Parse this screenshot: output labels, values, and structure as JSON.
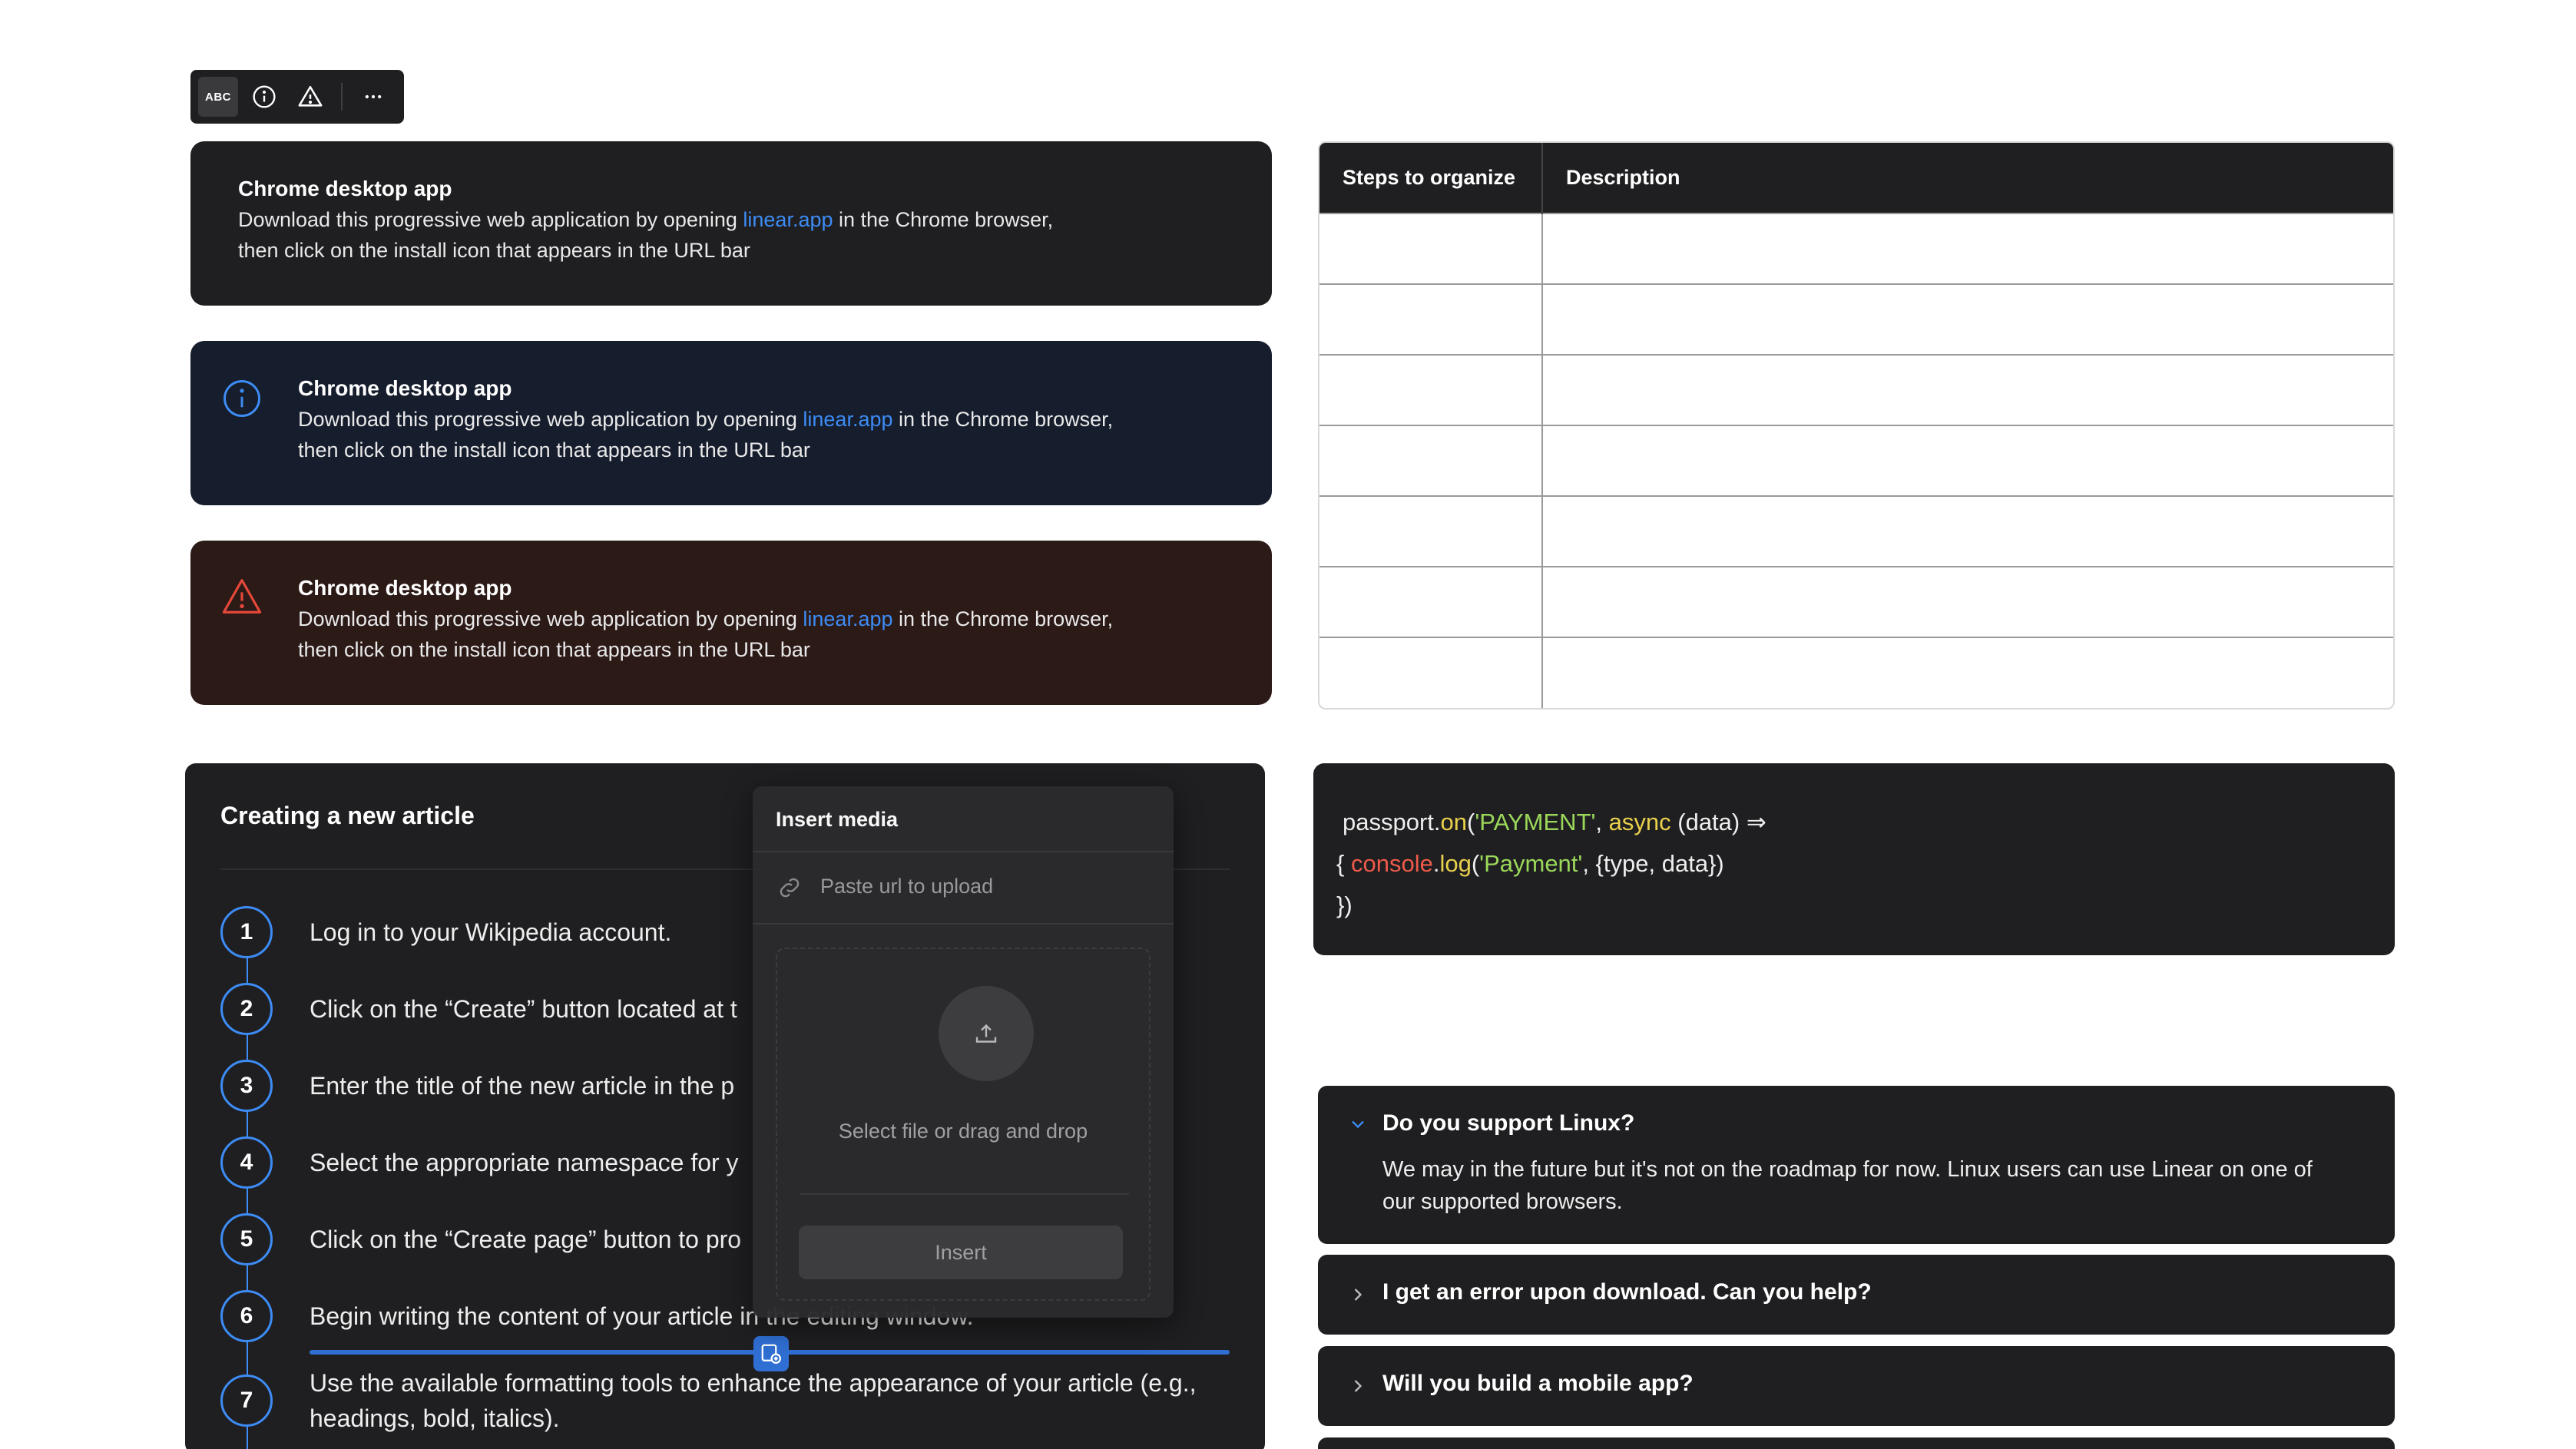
{
  "toolbar": {
    "abc_label": "ABC"
  },
  "callouts": [
    {
      "title": "Chrome desktop app",
      "body_before": "Download this progressive web application by opening ",
      "link": "linear.app",
      "body_after": " in the Chrome browser,",
      "body_line2": "then click on the install icon that appears in the URL bar",
      "variant": "default",
      "bg": "#1f1f21"
    },
    {
      "title": "Chrome desktop app",
      "body_before": "Download this progressive web application by opening ",
      "link": "linear.app",
      "body_after": " in the Chrome browser,",
      "body_line2": "then click on the install icon that appears in the URL bar",
      "variant": "info",
      "bg": "#161d2c"
    },
    {
      "title": "Chrome desktop app",
      "body_before": "Download this progressive web application by opening ",
      "link": "linear.app",
      "body_after": " in the Chrome browser,",
      "body_line2": "then click on the install icon that appears in the URL bar",
      "variant": "warning",
      "bg": "#2c1a17"
    }
  ],
  "table": {
    "headers": [
      "Steps to organize",
      "Description"
    ],
    "empty_rows": 7
  },
  "article": {
    "title": "Creating a new article",
    "steps": [
      {
        "num": "1",
        "text": "Log in to your Wikipedia account."
      },
      {
        "num": "2",
        "text": "Click on the “Create” button located at t"
      },
      {
        "num": "3",
        "text": "Enter the title of the new article in the p"
      },
      {
        "num": "4",
        "text": "Select the appropriate namespace for y"
      },
      {
        "num": "5",
        "text": "Click on the “Create page” button to pro"
      },
      {
        "num": "6",
        "text": "Begin writing the content of your article in the editing window."
      },
      {
        "num": "7",
        "text": "Use the available formatting tools to enhance the appearance of your article (e.g., headings, bold, italics)."
      }
    ]
  },
  "insert_media": {
    "title": "Insert media",
    "url_placeholder": "Paste url to upload",
    "drop_text": "Select file or drag and drop",
    "insert_label": "Insert"
  },
  "code": {
    "line1": [
      [
        "passport.",
        "w"
      ],
      [
        "on",
        "y"
      ],
      [
        "(",
        "w"
      ],
      [
        "'PAYMENT'",
        "g"
      ],
      [
        ", ",
        "w"
      ],
      [
        "async",
        "y"
      ],
      [
        " (data) ⇒",
        "w"
      ]
    ],
    "line2": [
      [
        "{ ",
        "w"
      ],
      [
        "console",
        "r"
      ],
      [
        ".",
        "w"
      ],
      [
        "log",
        "y"
      ],
      [
        "(",
        "w"
      ],
      [
        "'Payment'",
        "g"
      ],
      [
        ", {type, data})",
        "w"
      ]
    ],
    "line3": [
      [
        "})",
        "w"
      ]
    ]
  },
  "faq": [
    {
      "question": "Do you support Linux?",
      "answer": "We may in the future but it's not on the roadmap for now. Linux users can use Linear on one of our supported browsers.",
      "expanded": true
    },
    {
      "question": "I get an error upon download. Can you help?",
      "expanded": false
    },
    {
      "question": "Will you build a mobile app?",
      "expanded": false
    }
  ],
  "colors": {
    "accent": "#3d8cf5",
    "warning": "#e5483a",
    "card_bg": "#1f1f21"
  }
}
